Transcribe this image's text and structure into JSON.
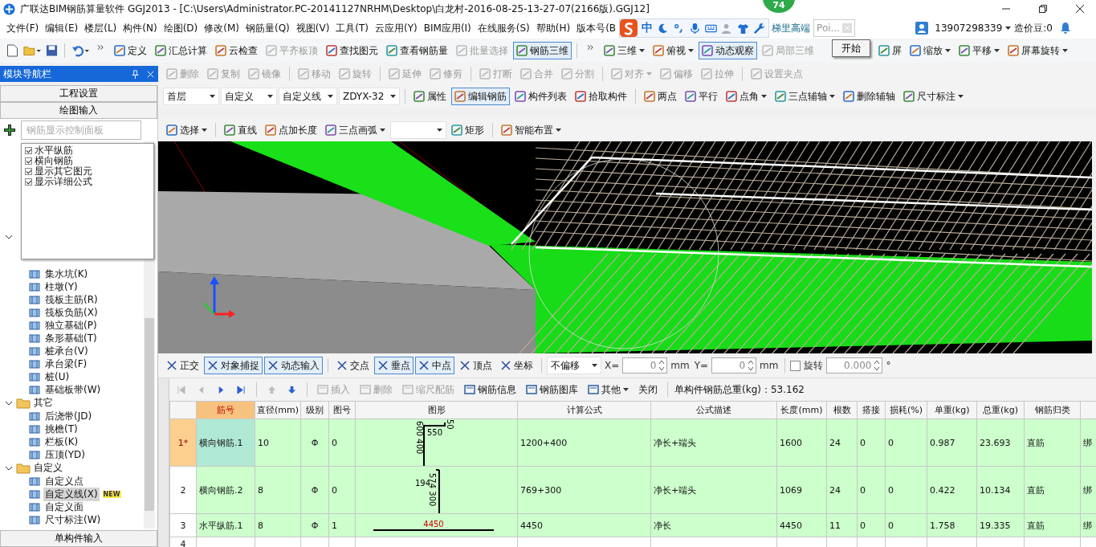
{
  "window": {
    "title": "广联达BIM钢筋算量软件 GGJ2013 - [C:\\Users\\Administrator.PC-20141127NRHM\\Desktop\\白龙村-2016-08-25-13-27-07(2166版).GGJ12]",
    "badge": "74"
  },
  "menu": {
    "items": [
      "文件(F)",
      "编辑(E)",
      "楼层(L)",
      "构件(N)",
      "绘图(D)",
      "修改(M)",
      "钢筋量(Q)",
      "视图(V)",
      "工具(T)",
      "云应用(Y)",
      "BIM应用(I)",
      "在线服务(S)",
      "帮助(H)",
      "版本号(B"
    ],
    "ime": {
      "label": "中"
    },
    "link": "梯里高端",
    "popup": {
      "text": "Poi...",
      "button": "开始"
    },
    "account": "13907298339",
    "beans": "造价豆:0"
  },
  "toolbar1": {
    "groups": [
      [
        {
          "kind": "button",
          "label": "定义",
          "disabled": false,
          "active": false,
          "dropdown": false
        },
        {
          "kind": "button",
          "label": "汇总计算",
          "disabled": false,
          "active": false,
          "dropdown": false
        },
        {
          "kind": "button",
          "label": "云检查",
          "disabled": false,
          "active": false,
          "dropdown": false
        },
        {
          "kind": "button",
          "label": "平齐板顶",
          "disabled": true,
          "active": false,
          "dropdown": false
        },
        {
          "kind": "button",
          "label": "查找图元",
          "disabled": false,
          "active": false,
          "dropdown": false
        },
        {
          "kind": "button",
          "label": "查看钢筋量",
          "disabled": false,
          "active": false,
          "dropdown": false
        },
        {
          "kind": "button",
          "label": "批量选择",
          "disabled": true,
          "active": false,
          "dropdown": false
        },
        {
          "kind": "button",
          "label": "钢筋三维",
          "disabled": false,
          "active": true,
          "dropdown": false
        }
      ],
      [
        {
          "kind": "button",
          "label": "三维",
          "disabled": false,
          "active": false,
          "dropdown": true
        },
        {
          "kind": "button",
          "label": "俯视",
          "disabled": false,
          "active": false,
          "dropdown": true
        },
        {
          "kind": "button",
          "label": "动态观察",
          "disabled": false,
          "active": true,
          "dropdown": false
        },
        {
          "kind": "button",
          "label": "局部三维",
          "disabled": true,
          "active": false,
          "dropdown": false
        },
        {
          "kind": "button",
          "label": "屏",
          "disabled": false,
          "active": false,
          "dropdown": false
        },
        {
          "kind": "button",
          "label": "缩放",
          "disabled": false,
          "active": false,
          "dropdown": true
        },
        {
          "kind": "button",
          "label": "平移",
          "disabled": false,
          "active": false,
          "dropdown": true
        },
        {
          "kind": "button",
          "label": "屏幕旋转",
          "disabled": false,
          "active": false,
          "dropdown": true
        }
      ]
    ]
  },
  "toolbar2": {
    "groups": [
      [
        {
          "kind": "button",
          "label": "删除",
          "disabled": true,
          "active": false,
          "dropdown": false
        },
        {
          "kind": "button",
          "label": "复制",
          "disabled": true,
          "active": false,
          "dropdown": false
        },
        {
          "kind": "button",
          "label": "镜像",
          "disabled": true,
          "active": false,
          "dropdown": false
        }
      ],
      [
        {
          "kind": "button",
          "label": "移动",
          "disabled": true,
          "active": false,
          "dropdown": false
        },
        {
          "kind": "button",
          "label": "旋转",
          "disabled": true,
          "active": false,
          "dropdown": false
        }
      ],
      [
        {
          "kind": "button",
          "label": "延伸",
          "disabled": true,
          "active": false,
          "dropdown": false
        },
        {
          "kind": "button",
          "label": "修剪",
          "disabled": true,
          "active": false,
          "dropdown": false
        }
      ],
      [
        {
          "kind": "button",
          "label": "打断",
          "disabled": true,
          "active": false,
          "dropdown": false
        },
        {
          "kind": "button",
          "label": "合并",
          "disabled": true,
          "active": false,
          "dropdown": false
        },
        {
          "kind": "button",
          "label": "分割",
          "disabled": true,
          "active": false,
          "dropdown": false
        }
      ],
      [
        {
          "kind": "button",
          "label": "对齐",
          "disabled": true,
          "active": false,
          "dropdown": true
        },
        {
          "kind": "button",
          "label": "偏移",
          "disabled": true,
          "active": false,
          "dropdown": false
        },
        {
          "kind": "button",
          "label": "拉伸",
          "disabled": true,
          "active": false,
          "dropdown": false
        }
      ],
      [
        {
          "kind": "button",
          "label": "设置夹点",
          "disabled": true,
          "active": false,
          "dropdown": false
        }
      ]
    ]
  },
  "toolbar3": {
    "groups": [
      [
        {
          "kind": "combo",
          "value": "首层"
        },
        {
          "kind": "combo",
          "value": "自定义"
        },
        {
          "kind": "combo",
          "value": "自定义线"
        },
        {
          "kind": "combo",
          "value": "ZDYX-32"
        }
      ],
      [
        {
          "kind": "button",
          "label": "属性",
          "disabled": false,
          "active": false,
          "dropdown": false
        },
        {
          "kind": "button",
          "label": "编辑钢筋",
          "disabled": false,
          "active": true,
          "dropdown": false
        },
        {
          "kind": "button",
          "label": "构件列表",
          "disabled": false,
          "active": false,
          "dropdown": false
        },
        {
          "kind": "button",
          "label": "拾取构件",
          "disabled": false,
          "active": false,
          "dropdown": false
        }
      ],
      [
        {
          "kind": "button",
          "label": "两点",
          "disabled": false,
          "active": false,
          "dropdown": false
        },
        {
          "kind": "button",
          "label": "平行",
          "disabled": false,
          "active": false,
          "dropdown": false
        },
        {
          "kind": "button",
          "label": "点角",
          "disabled": false,
          "active": false,
          "dropdown": true
        },
        {
          "kind": "button",
          "label": "三点辅轴",
          "disabled": false,
          "active": false,
          "dropdown": true
        },
        {
          "kind": "button",
          "label": "删除辅轴",
          "disabled": false,
          "active": false,
          "dropdown": false
        },
        {
          "kind": "button",
          "label": "尺寸标注",
          "disabled": false,
          "active": false,
          "dropdown": true
        }
      ]
    ]
  },
  "toolbar4": {
    "groups": [
      [
        {
          "kind": "button",
          "label": "选择",
          "disabled": false,
          "active": false,
          "dropdown": true
        }
      ],
      [
        {
          "kind": "button",
          "label": "直线",
          "disabled": false,
          "active": false,
          "dropdown": false
        },
        {
          "kind": "button",
          "label": "点加长度",
          "disabled": false,
          "active": false,
          "dropdown": false
        },
        {
          "kind": "button",
          "label": "三点画弧",
          "disabled": false,
          "active": false,
          "dropdown": true
        },
        {
          "kind": "combo"
        },
        {
          "kind": "button",
          "label": "矩形",
          "disabled": false,
          "active": false,
          "dropdown": false
        }
      ],
      [
        {
          "kind": "button",
          "label": "智能布置",
          "disabled": false,
          "active": false,
          "dropdown": true
        }
      ]
    ]
  },
  "nav": {
    "title": "模块导航栏",
    "sections": [
      "工程设置",
      "绘图输入"
    ],
    "footer": "单构件输入",
    "filter": {
      "placeholder": "钢筋显示控制面板"
    },
    "checklist": [
      {
        "label": "水平纵筋",
        "checked": true
      },
      {
        "label": "横向钢筋",
        "checked": true
      },
      {
        "label": "显示其它图元",
        "checked": true
      },
      {
        "label": "显示详细公式",
        "checked": true
      }
    ],
    "tree": [
      {
        "expanded": true,
        "children": [
          {
            "label": "集水坑(K)",
            "selected": false
          },
          {
            "label": "柱墩(Y)",
            "selected": false
          },
          {
            "label": "筏板主筋(R)",
            "selected": false
          },
          {
            "label": "筏板负筋(X)",
            "selected": false
          },
          {
            "label": "独立基础(P)",
            "selected": false
          },
          {
            "label": "条形基础(T)",
            "selected": false
          },
          {
            "label": "桩承台(V)",
            "selected": false
          },
          {
            "label": "承台梁(F)",
            "selected": false
          },
          {
            "label": "桩(U)",
            "selected": false
          },
          {
            "label": "基础板带(W)",
            "selected": false
          }
        ]
      },
      {
        "label": "其它",
        "expanded": true,
        "children": [
          {
            "label": "后浇带(JD)",
            "selected": false
          },
          {
            "label": "挑檐(T)",
            "selected": false
          },
          {
            "label": "栏板(K)",
            "selected": false
          },
          {
            "label": "压顶(YD)",
            "selected": false
          }
        ]
      },
      {
        "label": "自定义",
        "expanded": true,
        "children": [
          {
            "label": "自定义点",
            "selected": false
          },
          {
            "label": "自定义线(X)",
            "selected": true,
            "badge": "NEW"
          },
          {
            "label": "自定义面",
            "selected": false
          },
          {
            "label": "尺寸标注(W)",
            "selected": false
          }
        ]
      }
    ]
  },
  "snapbar": {
    "items": [
      {
        "label": "正交",
        "active": false
      },
      {
        "label": "对象捕捉",
        "active": true
      },
      {
        "label": "动态输入",
        "active": true
      },
      {
        "label": "交点",
        "active": false
      },
      {
        "label": "垂点",
        "active": true
      },
      {
        "label": "中点",
        "active": true
      },
      {
        "label": "顶点",
        "active": false
      },
      {
        "label": "坐标",
        "active": false
      }
    ],
    "offset": "不偏移",
    "x_label": "X=",
    "x_value": "0",
    "x_unit": "mm",
    "y_label": "Y=",
    "y_value": "0",
    "y_unit": "mm",
    "rotate": {
      "label": "旋转",
      "checked": false
    },
    "angle": "0.000",
    "degree": "°"
  },
  "rebar_toolbar": {
    "items": [
      {
        "label": "插入",
        "disabled": true,
        "dropdown": false
      },
      {
        "label": "删除",
        "disabled": true,
        "dropdown": false
      },
      {
        "label": "缩尺配筋",
        "disabled": true,
        "dropdown": false
      },
      {
        "label": "钢筋信息",
        "disabled": false,
        "dropdown": false
      },
      {
        "label": "钢筋图库",
        "disabled": false,
        "dropdown": false
      },
      {
        "label": "其他",
        "disabled": false,
        "dropdown": true
      }
    ],
    "close": "关闭",
    "total": "单构件钢筋总重(kg)：53.162"
  },
  "table": {
    "columns": [
      "筋号",
      "直径(mm)",
      "级别",
      "图号",
      "图形",
      "计算公式",
      "公式描述",
      "长度(mm)",
      "根数",
      "搭接",
      "损耗(%)",
      "单重(kg)",
      "总重(kg)",
      "钢筋归类"
    ],
    "rows": [
      {
        "index": "1*",
        "selected": true,
        "cells": [
          "横向钢筋.1",
          "10",
          "Φ",
          "0"
        ],
        "shape": {
          "kind": "bent",
          "labels": [
            "600 400",
            "550",
            "50"
          ]
        },
        "rest": [
          "1200+400",
          "净长+端头",
          "1600",
          "24",
          "0",
          "0",
          "0.987",
          "23.693",
          "直筋",
          "绑"
        ]
      },
      {
        "index": "2",
        "selected": false,
        "cells": [
          "横向钢筋.2",
          "8",
          "Φ",
          "0"
        ],
        "shape": {
          "kind": "hooked",
          "labels": [
            "194",
            "574 300"
          ]
        },
        "rest": [
          "769+300",
          "净长+端头",
          "1069",
          "24",
          "0",
          "0",
          "0.422",
          "10.134",
          "直筋",
          "绑"
        ]
      },
      {
        "index": "3",
        "selected": false,
        "cells": [
          "水平纵筋.1",
          "8",
          "Φ",
          "1"
        ],
        "shape": {
          "kind": "straight",
          "labels": [
            "4450"
          ]
        },
        "rest": [
          "4450",
          "净长",
          "4450",
          "11",
          "0",
          "0",
          "1.758",
          "19.335",
          "直筋",
          "绑"
        ]
      },
      {
        "index": "4",
        "selected": false
      }
    ]
  }
}
